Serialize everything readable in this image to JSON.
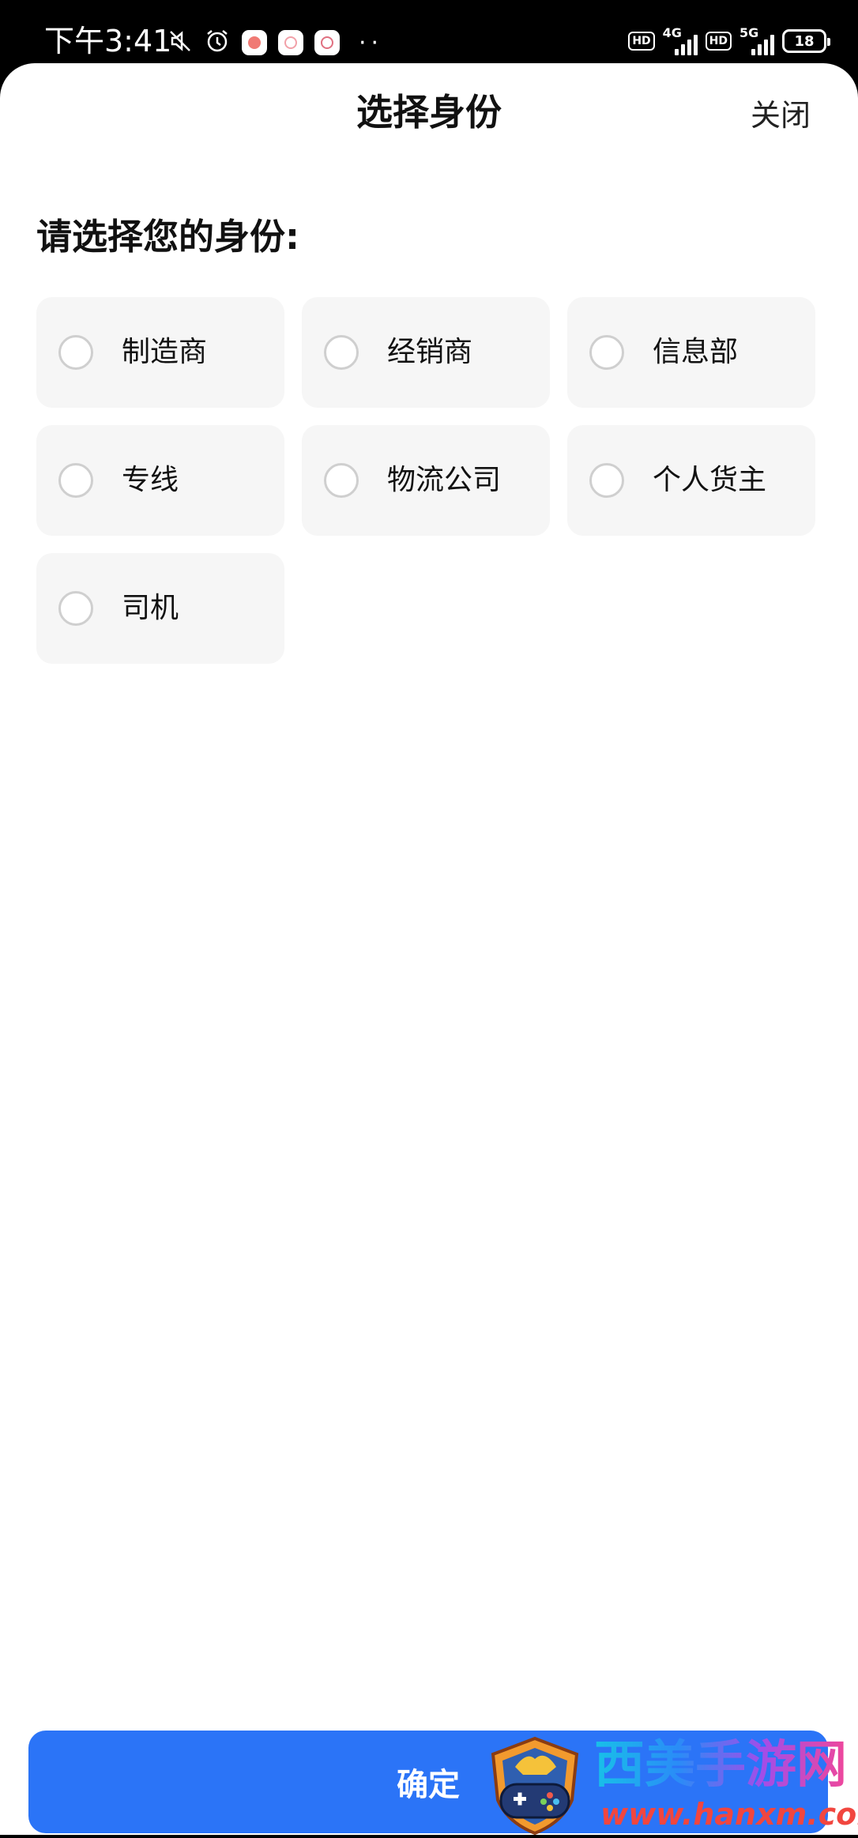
{
  "status_bar": {
    "time": "下午3:41",
    "hd_badge": "HD",
    "network_1": "4G",
    "network_2": "5G",
    "battery": "18",
    "icons": [
      "mute-icon",
      "alarm-icon",
      "app-notification-icon",
      "app-notification-icon",
      "app-notification-icon"
    ]
  },
  "sheet": {
    "title": "选择身份",
    "close_label": "关闭",
    "prompt": "请选择您的身份:",
    "options": [
      {
        "label": "制造商",
        "selected": false
      },
      {
        "label": "经销商",
        "selected": false
      },
      {
        "label": "信息部",
        "selected": false
      },
      {
        "label": "专线",
        "selected": false
      },
      {
        "label": "物流公司",
        "selected": false
      },
      {
        "label": "个人货主",
        "selected": false
      },
      {
        "label": "司机",
        "selected": false
      }
    ],
    "confirm_label": "确定"
  },
  "watermark": {
    "site_name": "西美手游网",
    "url": "www.hanxm.com"
  },
  "colors": {
    "primary": "#2b74f7",
    "option_bg": "#f6f6f6",
    "radio_border": "#cfcfcf"
  }
}
